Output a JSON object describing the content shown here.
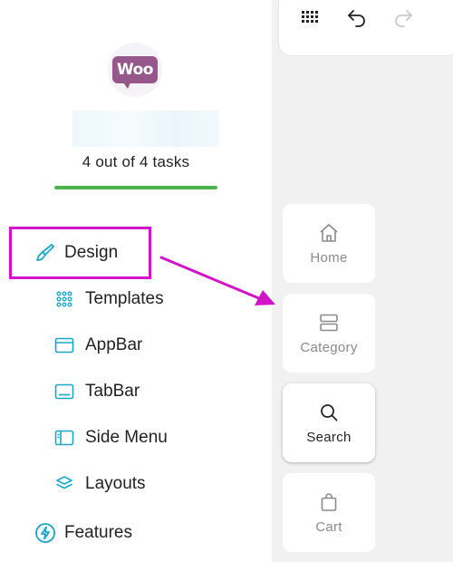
{
  "sidebar": {
    "progress": {
      "label": "4 out of 4 tasks",
      "completed": 4,
      "total": 4
    },
    "design": {
      "label": "Design"
    },
    "sub_items": [
      {
        "label": "Templates",
        "icon": "grid-dots-icon"
      },
      {
        "label": "AppBar",
        "icon": "window-icon"
      },
      {
        "label": "TabBar",
        "icon": "tabbar-icon"
      },
      {
        "label": "Side Menu",
        "icon": "side-menu-icon"
      },
      {
        "label": "Layouts",
        "icon": "layers-icon"
      }
    ],
    "features": {
      "label": "Features"
    }
  },
  "preview": {
    "tabs": [
      {
        "label": "Home",
        "icon": "home-icon",
        "active": false
      },
      {
        "label": "Category",
        "icon": "category-icon",
        "active": false
      },
      {
        "label": "Search",
        "icon": "search-icon",
        "active": true
      },
      {
        "label": "Cart",
        "icon": "cart-icon",
        "active": false
      }
    ]
  },
  "colors": {
    "accent_cyan": "#1aa7c5",
    "highlight_magenta": "#d214c8",
    "progress_green": "#4bb34b",
    "logo_purple": "#96588a"
  }
}
